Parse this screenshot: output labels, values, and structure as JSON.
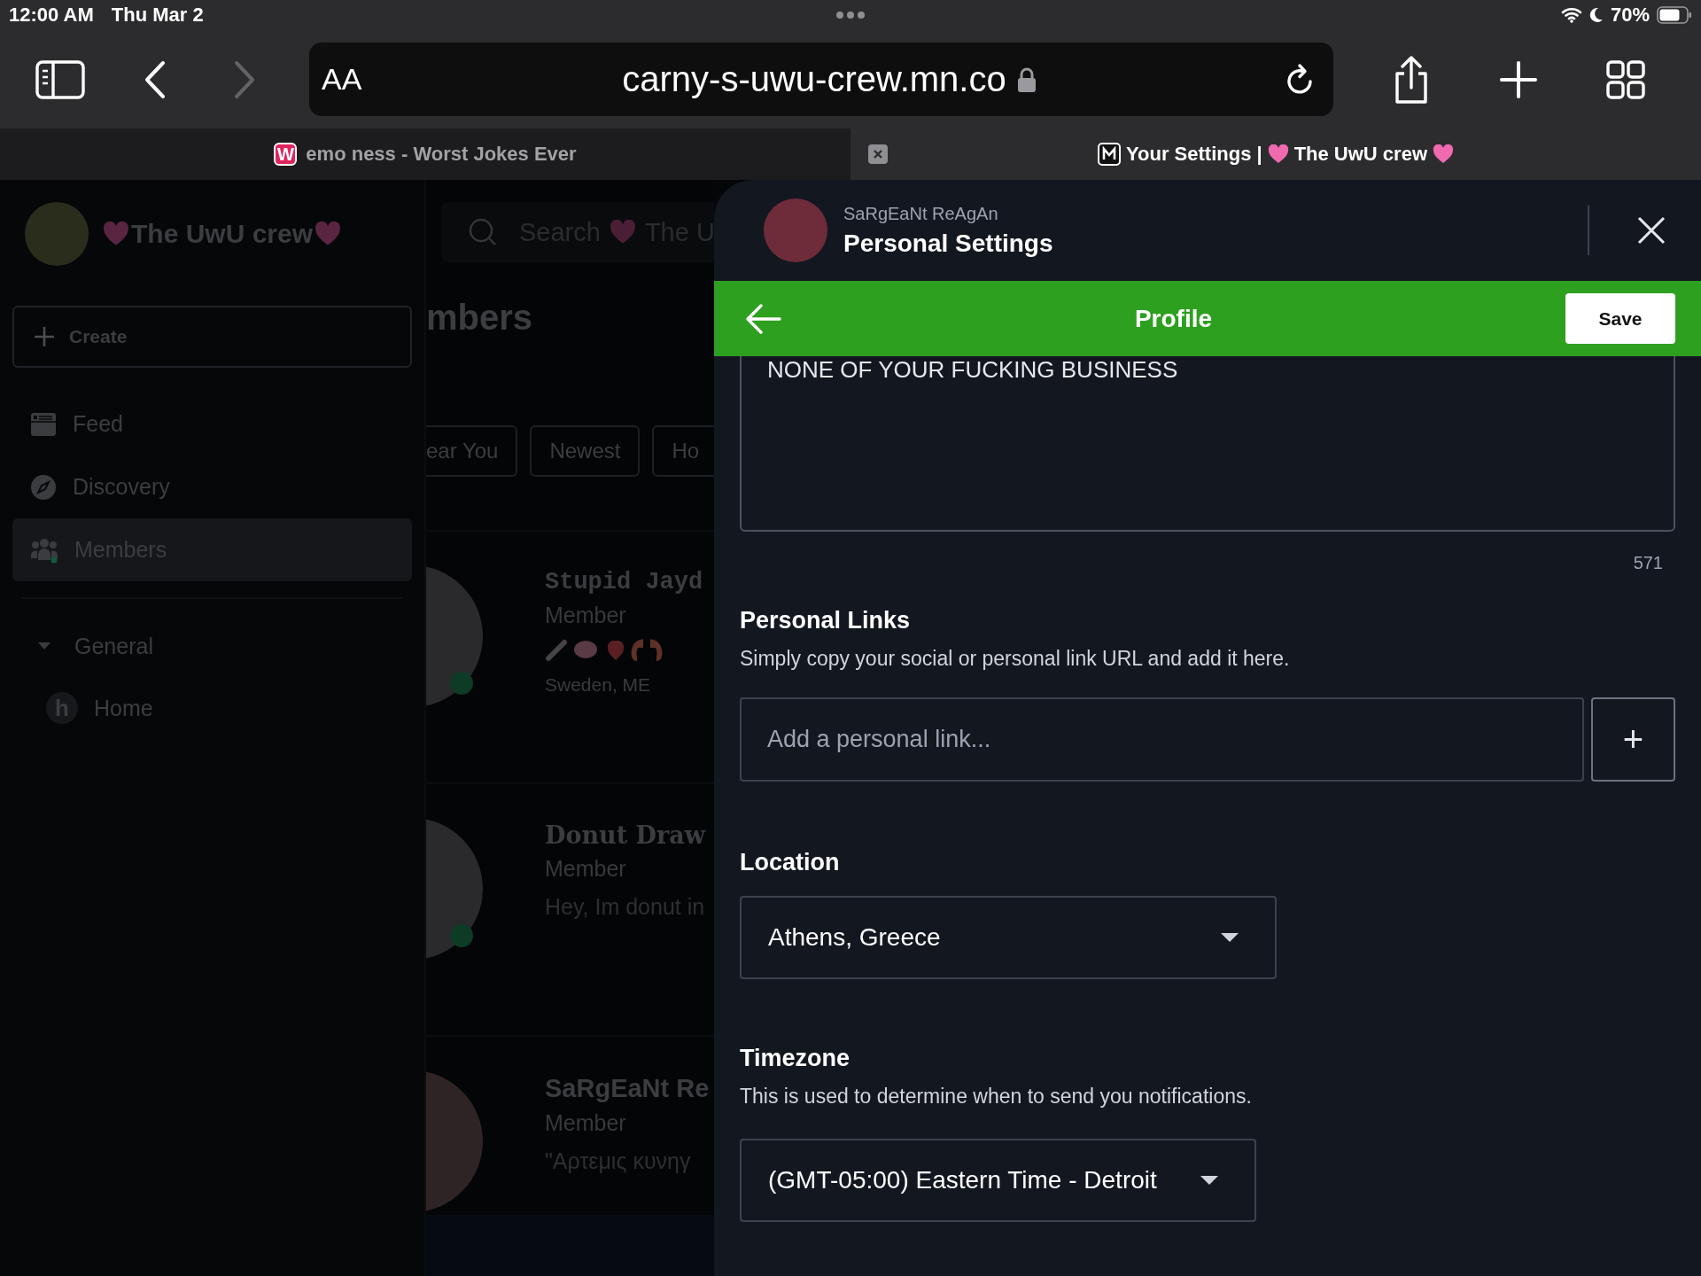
{
  "status_bar": {
    "time": "12:00 AM",
    "date": "Thu Mar 2",
    "battery": "70%"
  },
  "browser": {
    "text_size_button": "AA",
    "url": "carny-s-uwu-crew.mn.co",
    "tabs": [
      {
        "favicon_letter": "W",
        "title": "emo ness - Worst Jokes Ever",
        "selected": false
      },
      {
        "title": "Your Settings |",
        "community": "The UwU crew",
        "selected": true
      }
    ]
  },
  "sidebar": {
    "community": "The UwU crew",
    "create_button": "Create",
    "nav": [
      {
        "kind": "feed",
        "label": "Feed",
        "selected": false
      },
      {
        "kind": "discovery",
        "label": "Discovery",
        "selected": false
      },
      {
        "kind": "members",
        "label": "Members",
        "selected": true
      }
    ],
    "section": {
      "label": "General",
      "expanded": true,
      "children": [
        {
          "icon_letter": "h",
          "label": "Home"
        }
      ]
    }
  },
  "members_page": {
    "search_placeholder": "Search",
    "search_community": "The U",
    "title": "mbers",
    "filters": [
      "ear You",
      "Newest",
      "Ho"
    ],
    "members": [
      {
        "kind": "mono",
        "name": "Stupid Jayd",
        "role": "Member",
        "emoji": true,
        "detail": "Sweden, ME",
        "online": true
      },
      {
        "kind": "gothic",
        "name": "Donut Draw",
        "role": "Member",
        "emoji": false,
        "detail": "Hey, Im donut in",
        "online": true
      },
      {
        "kind": "plain",
        "name": "SaRgEaNt Re",
        "role": "Member",
        "emoji": false,
        "detail": "\"Αρτεμις κυνηγ",
        "online": false
      }
    ]
  },
  "settings_panel": {
    "user": "SaRgEaNt ReAgAn",
    "title": "Personal Settings",
    "section": "Profile",
    "save_button": "Save",
    "bio": "NONE OF YOUR FUCKING BUSINESS",
    "bio_counter": "571",
    "links": {
      "heading": "Personal Links",
      "description": "Simply copy your social or personal link URL and add it here.",
      "placeholder": "Add a personal link...",
      "add_button": "+"
    },
    "location": {
      "heading": "Location",
      "value": "Athens, Greece"
    },
    "timezone": {
      "heading": "Timezone",
      "description": "This is used to determine when to send you notifications.",
      "value": "(GMT-05:00) Eastern Time - Detroit"
    }
  }
}
